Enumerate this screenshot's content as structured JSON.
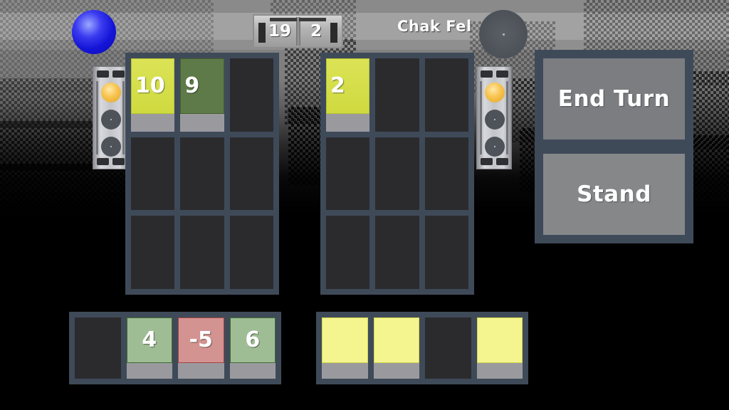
{
  "header": {
    "score_left": "19",
    "score_right": "2",
    "player_name": "Chak Fel"
  },
  "colors": {
    "board_frame": "#3f4a59",
    "slot_empty": "#2b2b2e",
    "card_yellow": "#cfda3f",
    "card_green": "#5d7a48",
    "card_sage": "#9fbd94",
    "card_rose": "#d39391",
    "card_facedown": "#f4f58f",
    "card_foot": "#9a9a9e",
    "button": "#7b7d80",
    "orb_lit": "#f7c34e",
    "sphere_blue": "#3b3bf0",
    "sphere_gray": "#4e535a"
  },
  "player": {
    "sphere": "blue-sphere",
    "tower": {
      "orbs": [
        "lit",
        "dim",
        "dim"
      ]
    }
  },
  "opponent": {
    "sphere": "gray-sphere",
    "tower": {
      "orbs": [
        "lit",
        "dim",
        "dim"
      ]
    }
  },
  "board_left": {
    "label": "player-board",
    "rows": [
      [
        {
          "value": "10",
          "style": "c-yellow",
          "empty": false
        },
        {
          "value": "9",
          "style": "c-green",
          "empty": false
        },
        {
          "value": "",
          "style": "",
          "empty": true
        }
      ],
      [
        {
          "value": "",
          "style": "",
          "empty": true
        },
        {
          "value": "",
          "style": "",
          "empty": true
        },
        {
          "value": "",
          "style": "",
          "empty": true
        }
      ],
      [
        {
          "value": "",
          "style": "",
          "empty": true
        },
        {
          "value": "",
          "style": "",
          "empty": true
        },
        {
          "value": "",
          "style": "",
          "empty": true
        }
      ]
    ]
  },
  "board_right": {
    "label": "opponent-board",
    "rows": [
      [
        {
          "value": "2",
          "style": "c-yellow",
          "empty": false
        },
        {
          "value": "",
          "style": "",
          "empty": true
        },
        {
          "value": "",
          "style": "",
          "empty": true
        }
      ],
      [
        {
          "value": "",
          "style": "",
          "empty": true
        },
        {
          "value": "",
          "style": "",
          "empty": true
        },
        {
          "value": "",
          "style": "",
          "empty": true
        }
      ],
      [
        {
          "value": "",
          "style": "",
          "empty": true
        },
        {
          "value": "",
          "style": "",
          "empty": true
        },
        {
          "value": "",
          "style": "",
          "empty": true
        }
      ]
    ]
  },
  "hand_left": {
    "label": "player-hand",
    "cards": [
      {
        "value": "",
        "style": "",
        "empty": true
      },
      {
        "value": "4",
        "style": "c-sage",
        "empty": false
      },
      {
        "value": "-5",
        "style": "c-rose",
        "empty": false
      },
      {
        "value": "6",
        "style": "c-sage",
        "empty": false
      }
    ]
  },
  "hand_right": {
    "label": "opponent-hand",
    "cards": [
      {
        "value": "",
        "style": "c-facedown",
        "empty": false
      },
      {
        "value": "",
        "style": "c-facedown",
        "empty": false
      },
      {
        "value": "",
        "style": "",
        "empty": true
      },
      {
        "value": "",
        "style": "c-facedown",
        "empty": false
      }
    ]
  },
  "actions": {
    "end_turn_label": "End Turn",
    "stand_label": "Stand"
  }
}
